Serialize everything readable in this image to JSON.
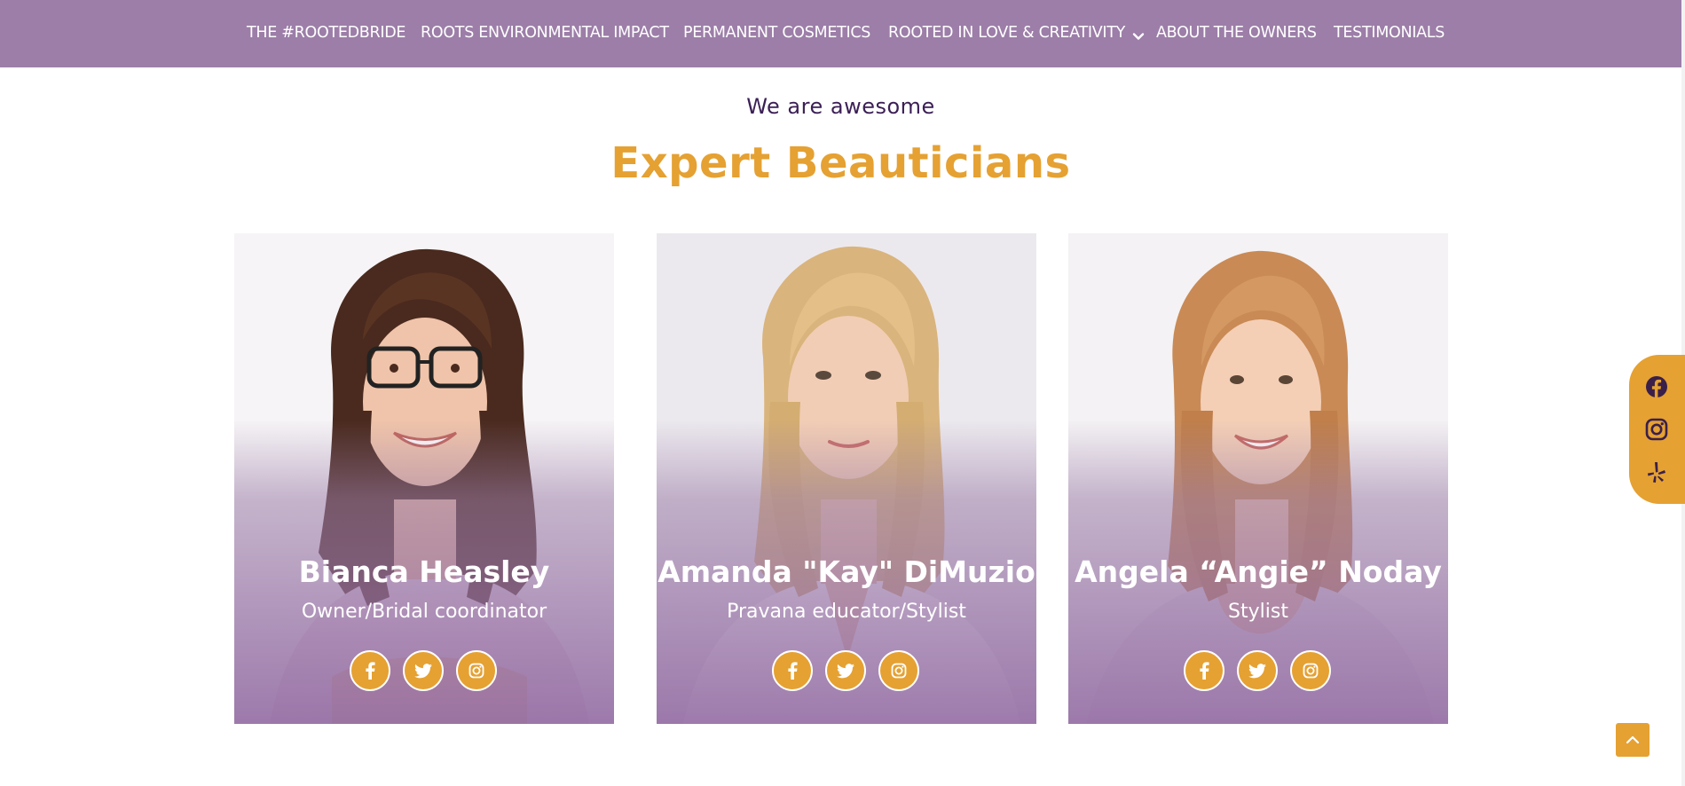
{
  "nav": {
    "items": [
      {
        "label": "THE #ROOTEDBRIDE"
      },
      {
        "label": "ROOTS ENVIRONMENTAL IMPACT"
      },
      {
        "label": "PERMANENT COSMETICS"
      },
      {
        "label": "ROOTED IN LOVE & CREATIVITY",
        "dropdown_icon": "chevron-down-icon"
      },
      {
        "label": "ABOUT THE OWNERS"
      },
      {
        "label": "TESTIMONIALS"
      }
    ]
  },
  "section": {
    "eyebrow": "We are awesome",
    "title": "Expert Beauticians"
  },
  "team": [
    {
      "name": "Bianca Heasley",
      "role": "Owner/Bridal coordinator",
      "photo": "woman-with-glasses-photo",
      "socials": [
        "facebook-icon",
        "twitter-icon",
        "instagram-icon"
      ]
    },
    {
      "name": "Amanda \"Kay\" DiMuzio",
      "role": "Pravana educator/Stylist",
      "photo": "blonde-woman-photo",
      "socials": [
        "facebook-icon",
        "twitter-icon",
        "instagram-icon"
      ]
    },
    {
      "name": "Angela “Angie” Noday",
      "role": "Stylist",
      "photo": "smiling-woman-photo",
      "socials": [
        "facebook-icon",
        "twitter-icon",
        "instagram-icon"
      ]
    }
  ],
  "floating_social": [
    "facebook-icon",
    "instagram-icon",
    "yelp-icon"
  ],
  "back_to_top_icon": "chevron-up-icon",
  "colors": {
    "nav_bg": "#9c7ea8",
    "accent_gold": "#e5a132",
    "eyebrow_purple": "#3c1f56",
    "card_overlay": "#936ca3",
    "text_white": "#ffffff"
  }
}
